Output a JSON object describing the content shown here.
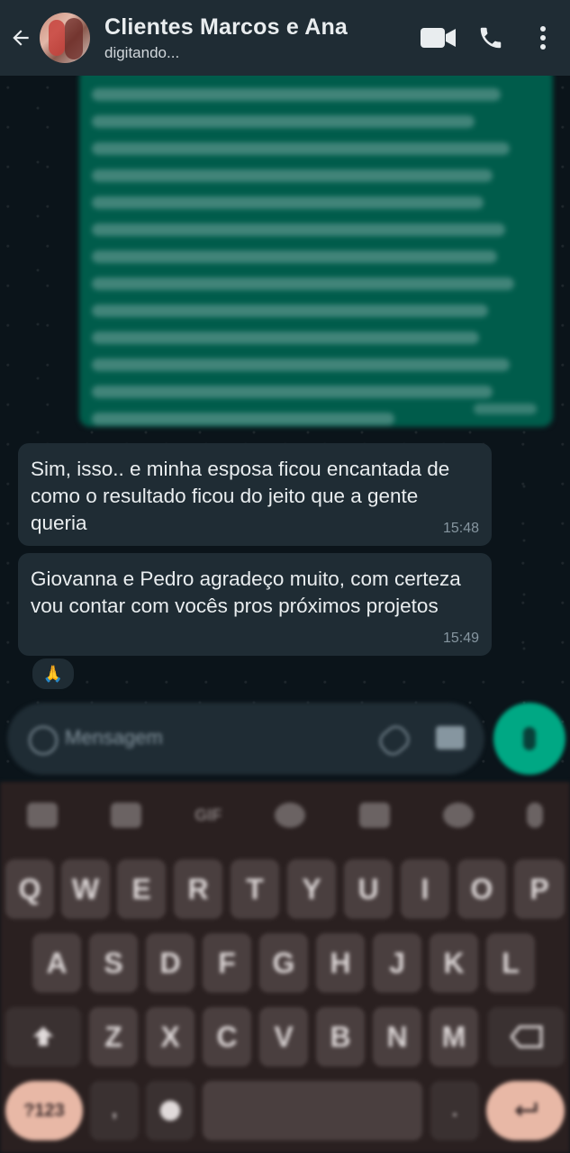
{
  "header": {
    "title": "Clientes Marcos e Ana",
    "subtitle": "digitando...",
    "icons": [
      "back-arrow-icon",
      "avatar",
      "video-call-icon",
      "voice-call-icon",
      "more-options-icon"
    ]
  },
  "messages": [
    {
      "text": "Sim, isso.. e minha esposa ficou encantada de como o resultado ficou do jeito que a gente queria",
      "time": "15:48"
    },
    {
      "text": "Giovanna e Pedro agradeço muito, com certeza vou contar com vocês pros próximos projetos",
      "time": "15:49"
    }
  ],
  "reaction": "🙏",
  "composer": {
    "placeholder": "Mensagem"
  },
  "keyboard": {
    "row1": [
      "Q",
      "W",
      "E",
      "R",
      "T",
      "Y",
      "U",
      "I",
      "O",
      "P"
    ],
    "row2": [
      "A",
      "S",
      "D",
      "F",
      "G",
      "H",
      "J",
      "K",
      "L"
    ],
    "row3": [
      "Z",
      "X",
      "C",
      "V",
      "B",
      "N",
      "M"
    ],
    "mode_key": "?123",
    "gif": "GIF"
  },
  "colors": {
    "header": "#1f2c34",
    "incoming": "#1f2c34",
    "outgoing": "#005c4b",
    "accent": "#00a884",
    "background": "#0b141a"
  }
}
